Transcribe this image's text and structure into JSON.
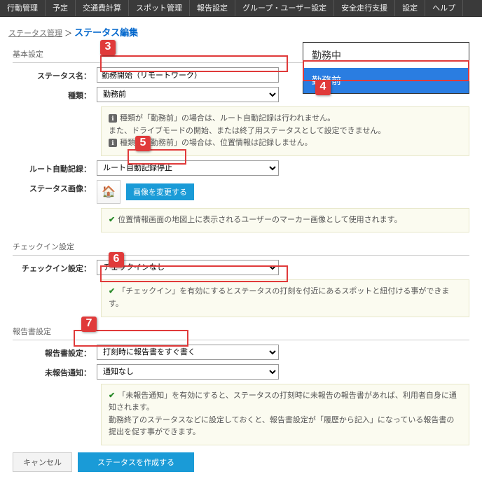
{
  "menu": [
    "行動管理",
    "予定",
    "交通費計算",
    "スポット管理",
    "報告設定",
    "グループ・ユーザー設定",
    "安全走行支援",
    "設定",
    "ヘルプ"
  ],
  "breadcrumb": {
    "root": "ステータス管理",
    "current": "ステータス編集"
  },
  "basic": {
    "heading": "基本設定",
    "name_lbl": "ステータス名：",
    "name_val": "勤務開始（リモートワーク）",
    "type_lbl": "種類：",
    "type_val": "勤務前",
    "hint1": "種類が「勤務前」の場合は、ルート自動記録は行われません。",
    "hint2": "また、ドライブモードの開始、または終了用ステータスとして設定できません。",
    "hint3": "種類が「勤務前」の場合は、位置情報は記録しません。",
    "route_lbl": "ルート自動記録：",
    "route_val": "ルート自動記録停止",
    "img_lbl": "ステータス画像：",
    "img_btn": "画像を変更する",
    "img_hint": "位置情報画面の地図上に表示されるユーザーのマーカー画像として使用されます。"
  },
  "checkin": {
    "heading": "チェックイン設定",
    "lbl": "チェックイン設定：",
    "val": "チェックインなし",
    "hint": "「チェックイン」を有効にするとステータスの打刻を付近にあるスポットと紐付ける事ができます。"
  },
  "report": {
    "heading": "報告書設定",
    "lbl": "報告書設定：",
    "val": "打刻時に報告書をすぐ書く",
    "unreport_lbl": "未報告通知：",
    "unreport_val": "通知なし",
    "hint1": "「未報告通知」を有効にすると、ステータスの打刻時に未報告の報告書があれば、利用者自身に通知されます。",
    "hint2": "勤務終了のステータスなどに設定しておくと、報告書設定が「履歴から記入」になっている報告書の提出を促す事ができます。"
  },
  "buttons": {
    "cancel": "キャンセル",
    "create": "ステータスを作成する"
  },
  "dropdown": {
    "opt1": "勤務中",
    "opt2": "勤務前"
  },
  "callouts": {
    "c3": "3",
    "c4": "4",
    "c5": "5",
    "c6": "6",
    "c7": "7"
  }
}
